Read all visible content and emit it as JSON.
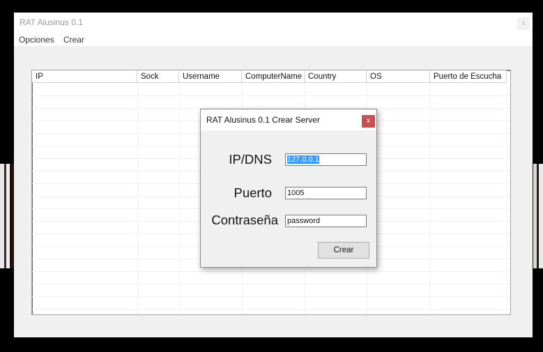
{
  "window": {
    "title": "RAT Alusinus 0.1",
    "close": "x"
  },
  "menu": {
    "items": [
      {
        "label": "Opciones"
      },
      {
        "label": "Crear"
      }
    ]
  },
  "listview": {
    "columns": [
      "IP",
      "Sock",
      "Username",
      "ComputerName",
      "Country",
      "OS",
      "Puerto de Escucha"
    ],
    "rows": []
  },
  "dialog": {
    "title": "RAT Alusinus 0.1 Crear Server",
    "close": "x",
    "fields": [
      {
        "label": "IP/DNS",
        "value": "127.0.0.1"
      },
      {
        "label": "Puerto",
        "value": "1005"
      },
      {
        "label": "Contraseña",
        "value": "password"
      }
    ],
    "button": "Crear"
  },
  "colors": {
    "close_button": "#c75050",
    "selection": "#3399ff"
  }
}
